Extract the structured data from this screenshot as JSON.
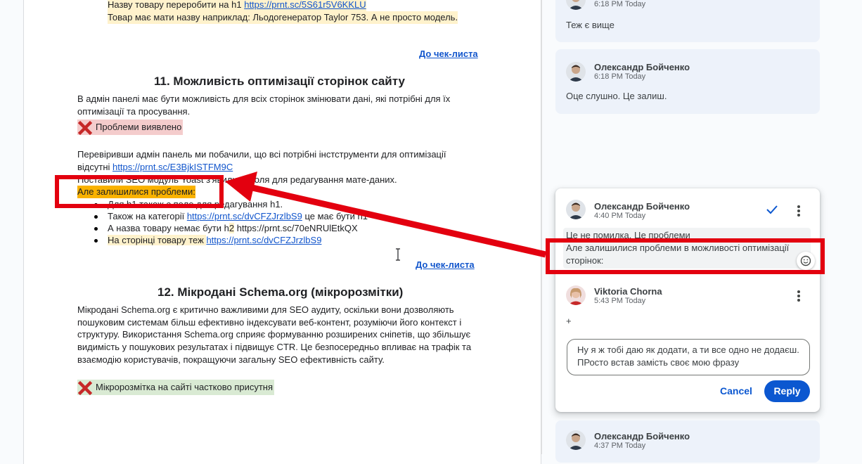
{
  "doc": {
    "top_line1_prefix": "Назву товару переробити на h1 ",
    "top_line1_link": "https://prnt.sc/5S61r5V6KKLU",
    "top_line2": "Товар має мати назву наприклад: Льодогенератор Taylor 753. А не просто модель.",
    "to_checklist_1": "До чек-листа",
    "section11_title": "11. Можливість оптимізації сторінок сайту",
    "section11_p1_l1": "В адмін панелі має бути можливість для всіх сторінок змінювати дані, які потрібні для їх",
    "section11_p1_l2": "оптимізації та просування.",
    "status_problem": "Проблеми виявлено",
    "section11_p2_l1": "Перевіривши адмін панель ми побачили, що всі потрібні інстструменти для оптимізації",
    "section11_p2_l2_prefix": "відсутні ",
    "section11_p2_l2_link": "https://prnt.sc/E3BjkISTFM9C",
    "section11_p3": "Поставили SEO модуль Yoast з'явилися поля для редагування мате-даних.",
    "remaining_problems": "Але залишилися проблеми:",
    "bullet1": "Для h1 також є поле для редагування h1.",
    "bullet2_prefix": "Також на категорії ",
    "bullet2_link": "https://prnt.sc/dvCFZJrzlbS9",
    "bullet2_suffix": " це має бути h1",
    "bullet3_prefix": "А назва товару немає бути h",
    "bullet3_mid": "2",
    "bullet3_suffix": " https://prnt.sc/70eNRUlEtkQX",
    "bullet4_prefix": "На сторінці товару теж ",
    "bullet4_link": "https://prnt.sc/dvCFZJrzlbS9",
    "to_checklist_2": "До чек-листа",
    "section12_title": "12. Мікродані Schema.org (мікророзмітки)",
    "section12_l1": "Мікродані Schema.org є критично важливими для SEO аудиту, оскільки вони дозволяють",
    "section12_l2": "пошуковим системам більш ефективно індексувати веб-контент, розуміючи його контекст і",
    "section12_l3": "структуру. Використання Schema.org сприяє формуванню розширених сніпетів, що збільшує",
    "section12_l4": "видимість у пошукових результатах і підвищує CTR. Це безпосередньо впливає на трафік та",
    "section12_l5": "взаємодію користувачів, покращуючи загальну SEO ефективність сайту.",
    "status_partial": "Мікророзмітка на сайті частково присутня"
  },
  "comments": {
    "c0": {
      "time": "6:18 PM Today",
      "text": "Теж є вище"
    },
    "c1": {
      "author": "Олександр Бойченко",
      "time": "6:18 PM Today",
      "text": "Оце слушно. Це залиш."
    },
    "active": {
      "author": "Олександр Бойченко",
      "time": "4:40 PM Today",
      "quote_l1": "Це не помилка. Це проблеми",
      "quote_l2": "Але залишилися проблеми в можливості оптимізації",
      "quote_l3": "сторінок:",
      "reply_author": "Viktoria Chorna",
      "reply_time": "5:43 PM Today",
      "reply_text": "+",
      "draft_l1": "Ну я ж тобі даю як додати, а ти все одно не додаєш.",
      "draft_l2": "ПРосто встав замість своє мою фразу",
      "cancel": "Cancel",
      "reply": "Reply"
    },
    "c3": {
      "author": "Олександр Бойченко",
      "time": "4:37 PM Today"
    }
  },
  "colors": {
    "annotation_red": "#e3000f",
    "reply_blue": "#0b57d0",
    "link_blue": "#1155cc"
  }
}
